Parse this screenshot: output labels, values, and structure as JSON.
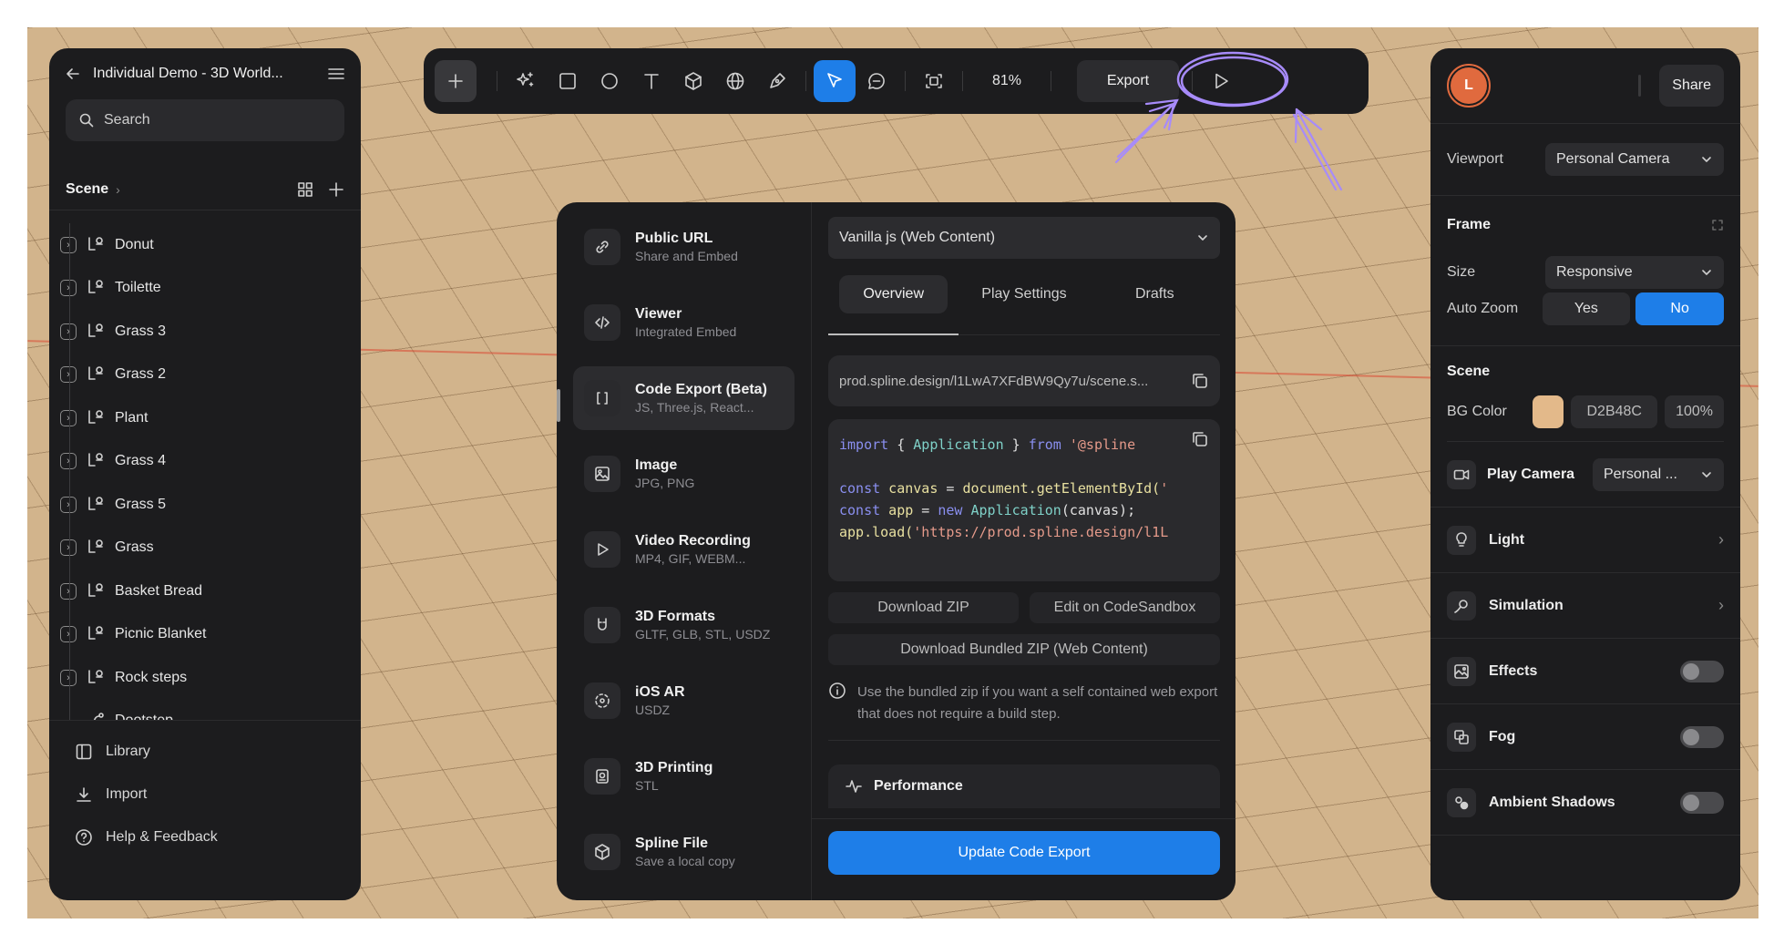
{
  "left_panel": {
    "title": "Individual Demo - 3D World...",
    "search_placeholder": "Search",
    "scene_label": "Scene",
    "layers": [
      "Donut",
      "Toilette",
      "Grass 3",
      "Grass 2",
      "Plant",
      "Grass 4",
      "Grass 5",
      "Grass",
      "Basket Bread",
      "Picnic Blanket",
      "Rock steps",
      "Dootstep"
    ],
    "footer": {
      "library": "Library",
      "import": "Import",
      "help": "Help & Feedback"
    }
  },
  "toolbar": {
    "zoom": "81%",
    "export_label": "Export"
  },
  "export_modal": {
    "options": [
      {
        "title": "Public URL",
        "subtitle": "Share and Embed",
        "icon": "link-icon"
      },
      {
        "title": "Viewer",
        "subtitle": "Integrated Embed",
        "icon": "code-icon"
      },
      {
        "title": "Code Export (Beta)",
        "subtitle": "JS, Three.js, React...",
        "icon": "brackets-icon"
      },
      {
        "title": "Image",
        "subtitle": "JPG, PNG",
        "icon": "image-icon"
      },
      {
        "title": "Video Recording",
        "subtitle": "MP4, GIF, WEBM...",
        "icon": "play-icon"
      },
      {
        "title": "3D Formats",
        "subtitle": "GLTF, GLB, STL, USDZ",
        "icon": "format-icon"
      },
      {
        "title": "iOS AR",
        "subtitle": "USDZ",
        "icon": "ar-icon"
      },
      {
        "title": "3D Printing",
        "subtitle": "STL",
        "icon": "printer-icon"
      },
      {
        "title": "Spline File",
        "subtitle": "Save a local copy",
        "icon": "cube-icon"
      }
    ],
    "framework_select": "Vanilla js (Web Content)",
    "tabs": [
      "Overview",
      "Play Settings",
      "Drafts"
    ],
    "url": "prod.spline.design/l1LwA7XFdBW9Qy7u/scene.s...",
    "code": {
      "line1_kw": "import",
      "line1_mid": " { ",
      "line1_cls": "Application",
      "line1_end": " } ",
      "line1_from": "from",
      "line1_str": " '@spline",
      "line2_kw": "const",
      "line2_var": " canvas",
      "line2_eq": " = ",
      "line2_fn": "document.getElementById(",
      "line2_str": "'",
      "line3_kw": "const",
      "line3_var": " app",
      "line3_eq": " = ",
      "line3_new": "new",
      "line3_cls": " Application",
      "line3_end": "(canvas);",
      "line4_fn": "app.load(",
      "line4_str": "'https://prod.spline.design/l1L"
    },
    "download_zip": "Download ZIP",
    "edit_codesandbox": "Edit on CodeSandbox",
    "download_bundled": "Download Bundled ZIP (Web Content)",
    "info_text": "Use the bundled zip if you want a self contained web export that does not require a build step.",
    "performance_label": "Performance",
    "update_button": "Update Code Export"
  },
  "right_panel": {
    "avatar_letter": "L",
    "share_label": "Share",
    "viewport_label": "Viewport",
    "viewport_value": "Personal Camera",
    "frame_label": "Frame",
    "size_label": "Size",
    "size_value": "Responsive",
    "autozoom_label": "Auto Zoom",
    "autozoom_yes": "Yes",
    "autozoom_no": "No",
    "scene_label": "Scene",
    "bgcolor_label": "BG Color",
    "bgcolor_hex": "D2B48C",
    "bgcolor_opacity": "100%",
    "bgcolor_swatch": "#e3b98a",
    "play_camera_label": "Play Camera",
    "play_camera_value": "Personal ...",
    "features": [
      {
        "name": "Light",
        "control": "chevron"
      },
      {
        "name": "Simulation",
        "control": "chevron"
      },
      {
        "name": "Effects",
        "control": "toggle"
      },
      {
        "name": "Fog",
        "control": "toggle"
      },
      {
        "name": "Ambient Shadows",
        "control": "toggle"
      }
    ]
  },
  "colors": {
    "accent": "#1e7ee8",
    "panel": "#1c1c1e",
    "annotation": "#a78bfa",
    "avatar": "#e06a3e"
  }
}
